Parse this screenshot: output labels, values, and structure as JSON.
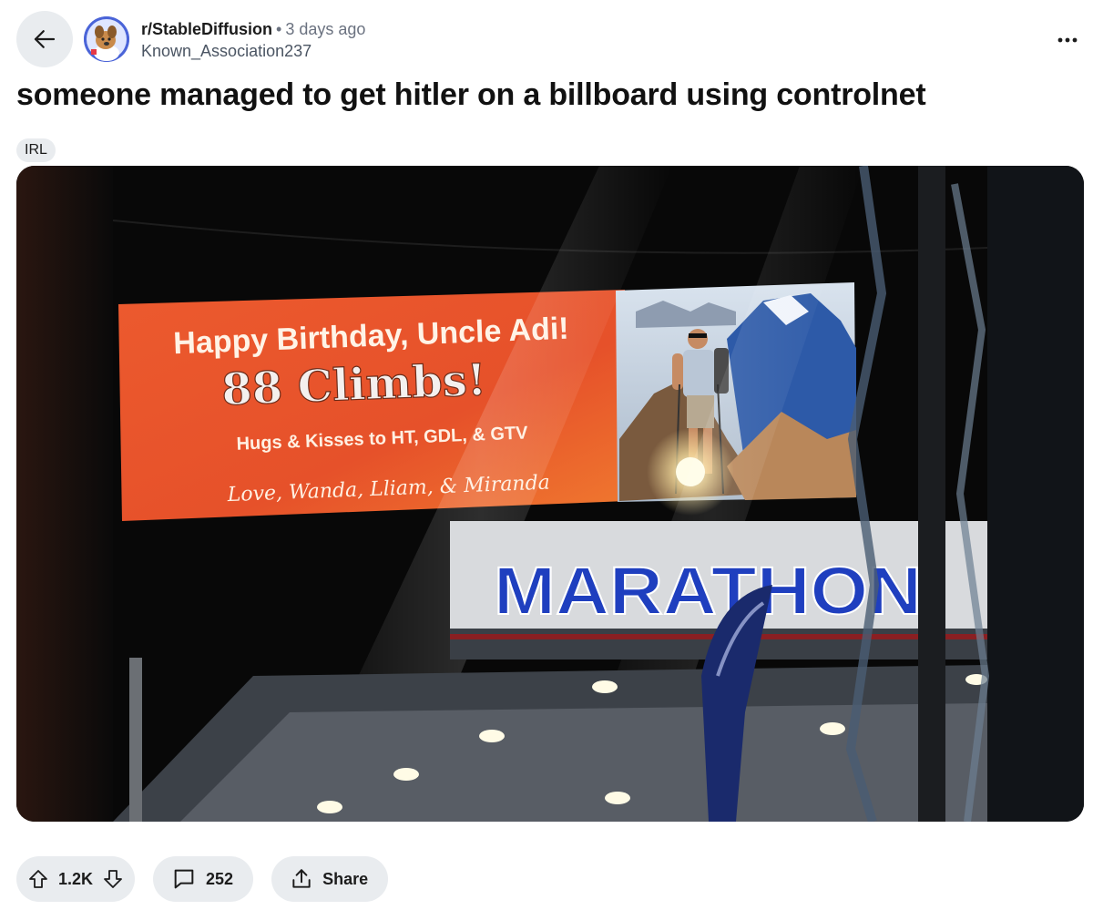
{
  "post": {
    "subreddit": "r/StableDiffusion",
    "time_ago": "3 days ago",
    "separator": "•",
    "author": "Known_Association237",
    "title": "someone managed to get hitler on a billboard using controlnet",
    "flair": "IRL"
  },
  "image": {
    "billboard_line1": "Happy Birthday, Uncle Adi!",
    "billboard_line2": "88 Climbs!",
    "billboard_line3": "Hugs & Kisses to HT, GDL, & GTV",
    "billboard_line4": "Love, Wanda, Lliam, & Miranda",
    "store_sign": "MARATHON"
  },
  "actions": {
    "upvotes": "1.2K",
    "comments": "252",
    "share_label": "Share"
  },
  "icons": {
    "back": "arrow-left-icon",
    "more": "ellipsis-icon",
    "upvote": "arrow-up-icon",
    "downvote": "arrow-down-icon",
    "comment": "comment-bubble-icon",
    "share": "share-icon"
  },
  "colors": {
    "pill_bg": "#e9ecef",
    "billboard_orange": "#e5522b",
    "sign_blue": "#1f3fbf"
  }
}
